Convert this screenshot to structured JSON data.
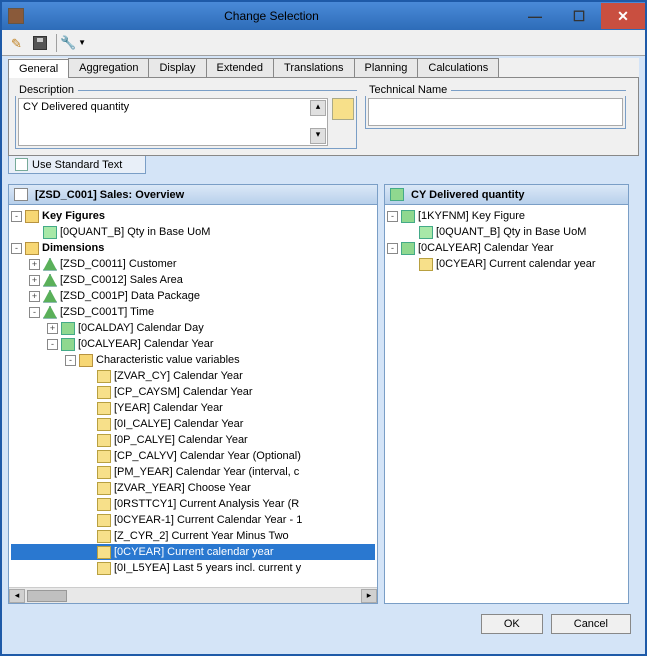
{
  "window": {
    "title": "Change Selection",
    "minimize": "—",
    "maximize": "☐",
    "close": "✕"
  },
  "tabs": {
    "items": [
      {
        "label": "General",
        "active": true
      },
      {
        "label": "Aggregation",
        "active": false
      },
      {
        "label": "Display",
        "active": false
      },
      {
        "label": "Extended",
        "active": false
      },
      {
        "label": "Translations",
        "active": false
      },
      {
        "label": "Planning",
        "active": false
      },
      {
        "label": "Calculations",
        "active": false
      }
    ]
  },
  "description": {
    "label": "Description",
    "value": "CY Delivered quantity"
  },
  "technical_name": {
    "label": "Technical Name",
    "value": ""
  },
  "use_standard_text": {
    "label": "Use Standard Text"
  },
  "left_panel": {
    "title": "[ZSD_C001] Sales: Overview"
  },
  "right_panel": {
    "title": "CY Delivered quantity"
  },
  "tree_left": [
    {
      "d": 0,
      "tgl": "-",
      "ico": "folder",
      "txt": "Key Figures",
      "b": true
    },
    {
      "d": 1,
      "tgl": "",
      "ico": "kf",
      "txt": "[0QUANT_B] Qty in Base UoM"
    },
    {
      "d": 0,
      "tgl": "-",
      "ico": "folder",
      "txt": "Dimensions",
      "b": true
    },
    {
      "d": 1,
      "tgl": "+",
      "ico": "dim",
      "txt": "[ZSD_C0011] Customer"
    },
    {
      "d": 1,
      "tgl": "+",
      "ico": "dim",
      "txt": "[ZSD_C0012] Sales Area"
    },
    {
      "d": 1,
      "tgl": "+",
      "ico": "dim",
      "txt": "[ZSD_C001P] Data Package"
    },
    {
      "d": 1,
      "tgl": "-",
      "ico": "dim",
      "txt": "[ZSD_C001T] Time"
    },
    {
      "d": 2,
      "tgl": "+",
      "ico": "char",
      "txt": "[0CALDAY] Calendar Day"
    },
    {
      "d": 2,
      "tgl": "-",
      "ico": "char",
      "txt": "[0CALYEAR] Calendar Year"
    },
    {
      "d": 3,
      "tgl": "-",
      "ico": "folder",
      "txt": "Characteristic value variables"
    },
    {
      "d": 4,
      "tgl": "",
      "ico": "var",
      "txt": "[ZVAR_CY] Calendar Year"
    },
    {
      "d": 4,
      "tgl": "",
      "ico": "var",
      "txt": "[CP_CAYSM] Calendar Year"
    },
    {
      "d": 4,
      "tgl": "",
      "ico": "var",
      "txt": "[YEAR] Calendar Year"
    },
    {
      "d": 4,
      "tgl": "",
      "ico": "var",
      "txt": "[0I_CALYE] Calendar Year"
    },
    {
      "d": 4,
      "tgl": "",
      "ico": "var",
      "txt": "[0P_CALYE] Calendar Year"
    },
    {
      "d": 4,
      "tgl": "",
      "ico": "var",
      "txt": "[CP_CALYV] Calendar Year (Optional)"
    },
    {
      "d": 4,
      "tgl": "",
      "ico": "var",
      "txt": "[PM_YEAR] Calendar Year (interval, c"
    },
    {
      "d": 4,
      "tgl": "",
      "ico": "var",
      "txt": "[ZVAR_YEAR] Choose Year"
    },
    {
      "d": 4,
      "tgl": "",
      "ico": "var",
      "txt": "[0RSTTCY1] Current Analysis Year (R"
    },
    {
      "d": 4,
      "tgl": "",
      "ico": "var",
      "txt": "[0CYEAR-1] Current Calendar Year - 1"
    },
    {
      "d": 4,
      "tgl": "",
      "ico": "var",
      "txt": "[Z_CYR_2] Current Year Minus Two"
    },
    {
      "d": 4,
      "tgl": "",
      "ico": "var",
      "txt": "[0CYEAR] Current calendar year",
      "sel": true
    },
    {
      "d": 4,
      "tgl": "",
      "ico": "var",
      "txt": "[0I_L5YEA] Last 5 years incl. current y"
    }
  ],
  "tree_right": [
    {
      "d": 0,
      "tgl": "-",
      "ico": "char",
      "txt": "[1KYFNM] Key Figure"
    },
    {
      "d": 1,
      "tgl": "",
      "ico": "kf",
      "txt": "[0QUANT_B] Qty in Base UoM"
    },
    {
      "d": 0,
      "tgl": "-",
      "ico": "char",
      "txt": "[0CALYEAR] Calendar Year"
    },
    {
      "d": 1,
      "tgl": "",
      "ico": "var",
      "txt": "[0CYEAR] Current calendar year"
    }
  ],
  "buttons": {
    "ok": "OK",
    "cancel": "Cancel"
  }
}
